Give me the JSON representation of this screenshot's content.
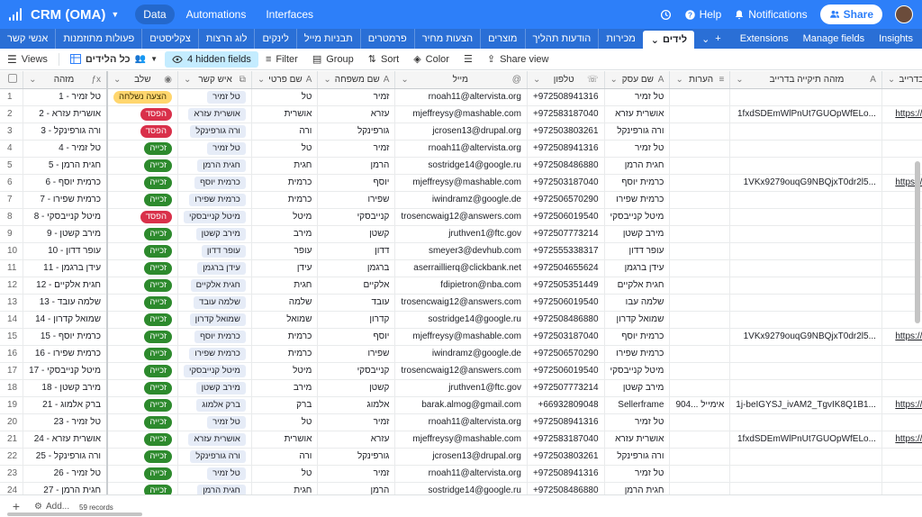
{
  "header": {
    "app_name": "CRM (OMA)",
    "nav": [
      {
        "label": "Data",
        "active": true
      },
      {
        "label": "Automations",
        "active": false
      },
      {
        "label": "Interfaces",
        "active": false
      }
    ],
    "help_label": "Help",
    "notifications_label": "Notifications",
    "share_label": "Share"
  },
  "tables": [
    {
      "label": "לידים",
      "active": true
    },
    {
      "label": "מכירות",
      "active": false
    },
    {
      "label": "הודעות תהליך",
      "active": false
    },
    {
      "label": "מוצרים",
      "active": false
    },
    {
      "label": "הצעות מחיר",
      "active": false
    },
    {
      "label": "פרמטרים",
      "active": false
    },
    {
      "label": "תבניות מייל",
      "active": false
    },
    {
      "label": "לינקים",
      "active": false
    },
    {
      "label": "לוג הרצות",
      "active": false
    },
    {
      "label": "צקליסטים",
      "active": false
    },
    {
      "label": "פעולות מתוזמנות",
      "active": false
    }
  ],
  "first_tab": "אנשי קשר",
  "tabs_right": {
    "extensions": "Extensions",
    "manage_fields": "Manage fields",
    "insights": "Insights"
  },
  "toolbar": {
    "views": "Views",
    "view_name": "כל הלידים",
    "hidden_fields": "4 hidden fields",
    "filter": "Filter",
    "group": "Group",
    "sort": "Sort",
    "color": "Color",
    "share_view": "Share view"
  },
  "columns": [
    {
      "key": "id",
      "label": "מזהה",
      "icon": "formula-icon"
    },
    {
      "key": "stage",
      "label": "שלב",
      "icon": "select-icon"
    },
    {
      "key": "contact",
      "label": "איש קשר",
      "icon": "link-icon"
    },
    {
      "key": "first",
      "label": "שם פרטי",
      "icon": "text-icon"
    },
    {
      "key": "last",
      "label": "שם משפחה",
      "icon": "text-icon"
    },
    {
      "key": "email",
      "label": "מייל",
      "icon": "email-icon"
    },
    {
      "key": "phone",
      "label": "טלפון",
      "icon": "phone-icon"
    },
    {
      "key": "business",
      "label": "שם עסק",
      "icon": "text-icon"
    },
    {
      "key": "notes",
      "label": "הערות",
      "icon": "notes-icon"
    },
    {
      "key": "drive_id",
      "label": "מזהה תיקייה בדרייב",
      "icon": "text-icon"
    },
    {
      "key": "drive_link",
      "label": "לינק לתיקייה בדרייב",
      "icon": "link-icon"
    }
  ],
  "stages": {
    "won": "זכייה",
    "lost": "הפסד",
    "proposal": "הצעה נשלחה"
  },
  "rows": [
    {
      "n": "1",
      "id": "טל זמיר - 1",
      "stage": "proposal",
      "contact": "טל זמיר",
      "first": "טל",
      "last": "זמיר",
      "email": "rnoah11@altervista.org",
      "phone": "+972508941316",
      "business": "טל זמיר",
      "notes": "",
      "drive_id": "",
      "drive_link": ""
    },
    {
      "n": "2",
      "id": "אושרית עזרא - 2",
      "stage": "lost",
      "contact": "אושרית עזרא",
      "first": "אושרית",
      "last": "עזרא",
      "email": "mjeffreysy@mashable.com",
      "phone": "+972583187040",
      "business": "אושרית עזרא",
      "notes": "",
      "drive_id": "1fxdSDEmWlPnUt7GUOpWfELo...",
      "drive_link": "https://drive.google.co"
    },
    {
      "n": "3",
      "id": "ורה גורפינקל - 3",
      "stage": "lost",
      "contact": "ורה גורפינקל",
      "first": "ורה",
      "last": "גורפינקל",
      "email": "jcrosen13@drupal.org",
      "phone": "+972503803261",
      "business": "ורה גורפינקל",
      "notes": "",
      "drive_id": "",
      "drive_link": ""
    },
    {
      "n": "4",
      "id": "טל זמיר - 4",
      "stage": "won",
      "contact": "טל זמיר",
      "first": "טל",
      "last": "זמיר",
      "email": "rnoah11@altervista.org",
      "phone": "+972508941316",
      "business": "טל זמיר",
      "notes": "",
      "drive_id": "",
      "drive_link": ""
    },
    {
      "n": "5",
      "id": "חגית הרמן - 5",
      "stage": "won",
      "contact": "חגית הרמן",
      "first": "חגית",
      "last": "הרמן",
      "email": "sostridge14@google.ru",
      "phone": "+972508486880",
      "business": "חגית הרמן",
      "notes": "",
      "drive_id": "",
      "drive_link": ""
    },
    {
      "n": "6",
      "id": "כרמית יוסף - 6",
      "stage": "won",
      "contact": "כרמית יוסף",
      "first": "כרמית",
      "last": "יוסף",
      "email": "mjeffreysy@mashable.com",
      "phone": "+972503187040",
      "business": "כרמית יוסף",
      "notes": "",
      "drive_id": "1VKx9279ouqG9NBQjxT0dr2l5...",
      "drive_link": "https://drive.google.co"
    },
    {
      "n": "7",
      "id": "כרמית שפירו - 7",
      "stage": "won",
      "contact": "כרמית שפירו",
      "first": "כרמית",
      "last": "שפירו",
      "email": "iwindramz@google.de",
      "phone": "+972506570290",
      "business": "כרמית שפירו",
      "notes": "",
      "drive_id": "",
      "drive_link": ""
    },
    {
      "n": "8",
      "id": "מיטל קנייבסקי - 8",
      "stage": "lost",
      "contact": "מיטל קנייבסקי",
      "first": "מיטל",
      "last": "קנייבסקי",
      "email": "trosencwaig12@answers.com",
      "phone": "+972506019540",
      "business": "מיטל קנייבסקי",
      "notes": "",
      "drive_id": "",
      "drive_link": ""
    },
    {
      "n": "9",
      "id": "מירב קשטן - 9",
      "stage": "won",
      "contact": "מירב קשטן",
      "first": "מירב",
      "last": "קשטן",
      "email": "jruthven1@ftc.gov",
      "phone": "+972507773214",
      "business": "מירב קשטן",
      "notes": "",
      "drive_id": "",
      "drive_link": ""
    },
    {
      "n": "10",
      "id": "עופר דדון - 10",
      "stage": "won",
      "contact": "עופר דדון",
      "first": "עופר",
      "last": "דדון",
      "email": "smeyer3@devhub.com",
      "phone": "+972555338317",
      "business": "עופר דדון",
      "notes": "",
      "drive_id": "",
      "drive_link": ""
    },
    {
      "n": "11",
      "id": "עידן ברגמן - 11",
      "stage": "won",
      "contact": "עידן ברגמן",
      "first": "עידן",
      "last": "ברגמן",
      "email": "aserraillierq@clickbank.net",
      "phone": "+972504655624",
      "business": "עידן ברגמן",
      "notes": "",
      "drive_id": "",
      "drive_link": ""
    },
    {
      "n": "12",
      "id": "חגית אלקיים - 12",
      "stage": "won",
      "contact": "חגית אלקיים",
      "first": "חגית",
      "last": "אלקיים",
      "email": "fdipietron@nba.com",
      "phone": "+972505351449",
      "business": "חגית אלקיים",
      "notes": "",
      "drive_id": "",
      "drive_link": ""
    },
    {
      "n": "13",
      "id": "שלמה עובד - 13",
      "stage": "won",
      "contact": "שלמה עובד",
      "first": "שלמה",
      "last": "עובד",
      "email": "trosencwaig12@answers.com",
      "phone": "+972506019540",
      "business": "שלמה עבו",
      "notes": "",
      "drive_id": "",
      "drive_link": ""
    },
    {
      "n": "14",
      "id": "שמואל קדרון - 14",
      "stage": "won",
      "contact": "שמואל קדרון",
      "first": "שמואל",
      "last": "קדרון",
      "email": "sostridge14@google.ru",
      "phone": "+972508486880",
      "business": "שמואל קדרון",
      "notes": "",
      "drive_id": "",
      "drive_link": ""
    },
    {
      "n": "15",
      "id": "כרמית יוסף - 15",
      "stage": "won",
      "contact": "כרמית יוסף",
      "first": "כרמית",
      "last": "יוסף",
      "email": "mjeffreysy@mashable.com",
      "phone": "+972503187040",
      "business": "כרמית יוסף",
      "notes": "",
      "drive_id": "1VKx9279ouqG9NBQjxT0dr2l5...",
      "drive_link": "https://drive.google.co"
    },
    {
      "n": "16",
      "id": "כרמית שפירו - 16",
      "stage": "won",
      "contact": "כרמית שפירו",
      "first": "כרמית",
      "last": "שפירו",
      "email": "iwindramz@google.de",
      "phone": "+972506570290",
      "business": "כרמית שפירו",
      "notes": "",
      "drive_id": "",
      "drive_link": ""
    },
    {
      "n": "17",
      "id": "מיטל קנייבסקי - 17",
      "stage": "won",
      "contact": "מיטל קנייבסקי",
      "first": "מיטל",
      "last": "קנייבסקי",
      "email": "trosencwaig12@answers.com",
      "phone": "+972506019540",
      "business": "מיטל קנייבסקי",
      "notes": "",
      "drive_id": "",
      "drive_link": ""
    },
    {
      "n": "18",
      "id": "מירב קשטן - 18",
      "stage": "won",
      "contact": "מירב קשטן",
      "first": "מירב",
      "last": "קשטן",
      "email": "jruthven1@ftc.gov",
      "phone": "+972507773214",
      "business": "מירב קשטן",
      "notes": "",
      "drive_id": "",
      "drive_link": ""
    },
    {
      "n": "19",
      "id": "ברק אלמוג - 21",
      "stage": "won",
      "contact": "ברק אלמוג",
      "first": "ברק",
      "last": "אלמוג",
      "email": "barak.almog@gmail.com",
      "phone": "+66932809048",
      "business": "Sellerframe",
      "notes": "904... אימייל",
      "drive_id": "1j-beIGYSJ_ivAM2_TgvIK8Q1B1...",
      "drive_link": "https://drive.google.co"
    },
    {
      "n": "20",
      "id": "טל זמיר - 23",
      "stage": "won",
      "contact": "טל זמיר",
      "first": "טל",
      "last": "זמיר",
      "email": "rnoah11@altervista.org",
      "phone": "+972508941316",
      "business": "טל זמיר",
      "notes": "",
      "drive_id": "",
      "drive_link": ""
    },
    {
      "n": "21",
      "id": "אושרית עזרא - 24",
      "stage": "won",
      "contact": "אושרית עזרא",
      "first": "אושרית",
      "last": "עזרא",
      "email": "mjeffreysy@mashable.com",
      "phone": "+972583187040",
      "business": "אושרית עזרא",
      "notes": "",
      "drive_id": "1fxdSDEmWlPnUt7GUOpWfELo...",
      "drive_link": "https://drive.google.co"
    },
    {
      "n": "22",
      "id": "ורה גורפינקל - 25",
      "stage": "won",
      "contact": "ורה גורפינקל",
      "first": "ורה",
      "last": "גורפינקל",
      "email": "jcrosen13@drupal.org",
      "phone": "+972503803261",
      "business": "ורה גורפינקל",
      "notes": "",
      "drive_id": "",
      "drive_link": ""
    },
    {
      "n": "23",
      "id": "טל זמיר - 26",
      "stage": "won",
      "contact": "טל זמיר",
      "first": "טל",
      "last": "זמיר",
      "email": "rnoah11@altervista.org",
      "phone": "+972508941316",
      "business": "טל זמיר",
      "notes": "",
      "drive_id": "",
      "drive_link": ""
    },
    {
      "n": "24",
      "id": "חגית הרמן - 27",
      "stage": "won",
      "contact": "חגית הרמן",
      "first": "חגית",
      "last": "הרמן",
      "email": "sostridge14@google.ru",
      "phone": "+972508486880",
      "business": "חגית הרמן",
      "notes": "",
      "drive_id": "",
      "drive_link": ""
    }
  ],
  "footer": {
    "add_label": "Add...",
    "records": "59 records"
  },
  "colors": {
    "brand": "#2d7ff9",
    "won": "#2d8a2d",
    "lost": "#d9304a",
    "proposal": "#ffd66e"
  }
}
